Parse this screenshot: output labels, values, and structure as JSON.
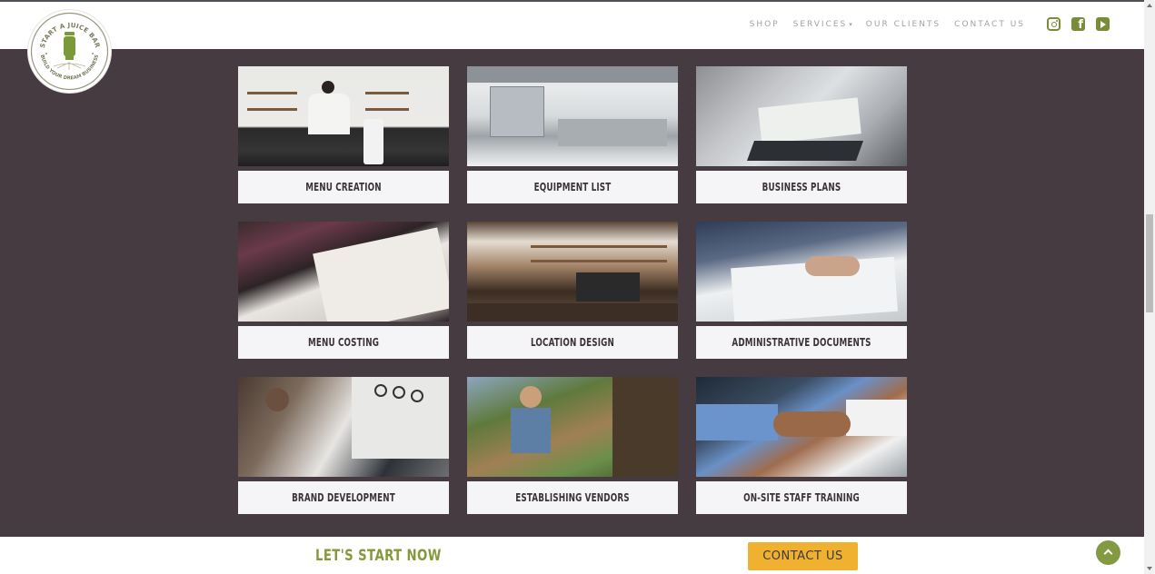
{
  "brand": {
    "logo_top_text": "START A JUICE BAR",
    "logo_bottom_text": "BUILD YOUR DREAM BUSINESS",
    "accent_color": "#7a8c36"
  },
  "nav": {
    "items": [
      {
        "label": "SHOP"
      },
      {
        "label": "SERVICES",
        "has_dropdown": true
      },
      {
        "label": "OUR CLIENTS"
      },
      {
        "label": "CONTACT US"
      }
    ],
    "dropdown_caret": "▾",
    "social": [
      {
        "icon": "instagram-icon"
      },
      {
        "icon": "facebook-icon",
        "glyph": "f"
      },
      {
        "icon": "youtube-icon"
      }
    ]
  },
  "services": [
    {
      "label": "MENU CREATION",
      "image": "woman preparing food in kitchen with blender"
    },
    {
      "label": "EQUIPMENT LIST",
      "image": "commercial stainless steel kitchen"
    },
    {
      "label": "BUSINESS PLANS",
      "image": "hands writing on documents by laptop"
    },
    {
      "label": "MENU COSTING",
      "image": "person reviewing printed menu"
    },
    {
      "label": "LOCATION DESIGN",
      "image": "cafe counter with espresso machine"
    },
    {
      "label": "ADMINISTRATIVE DOCUMENTS",
      "image": "hand signing paper"
    },
    {
      "label": "BRAND DEVELOPMENT",
      "image": "designer working on logos at computer"
    },
    {
      "label": "ESTABLISHING VENDORS",
      "image": "woman at outdoor produce market"
    },
    {
      "label": "ON-SITE STAFF TRAINING",
      "image": "handshake"
    }
  ],
  "footer": {
    "cta_text": "LET'S START NOW",
    "contact_button": "CONTACT US",
    "button_color": "#f0b030"
  }
}
